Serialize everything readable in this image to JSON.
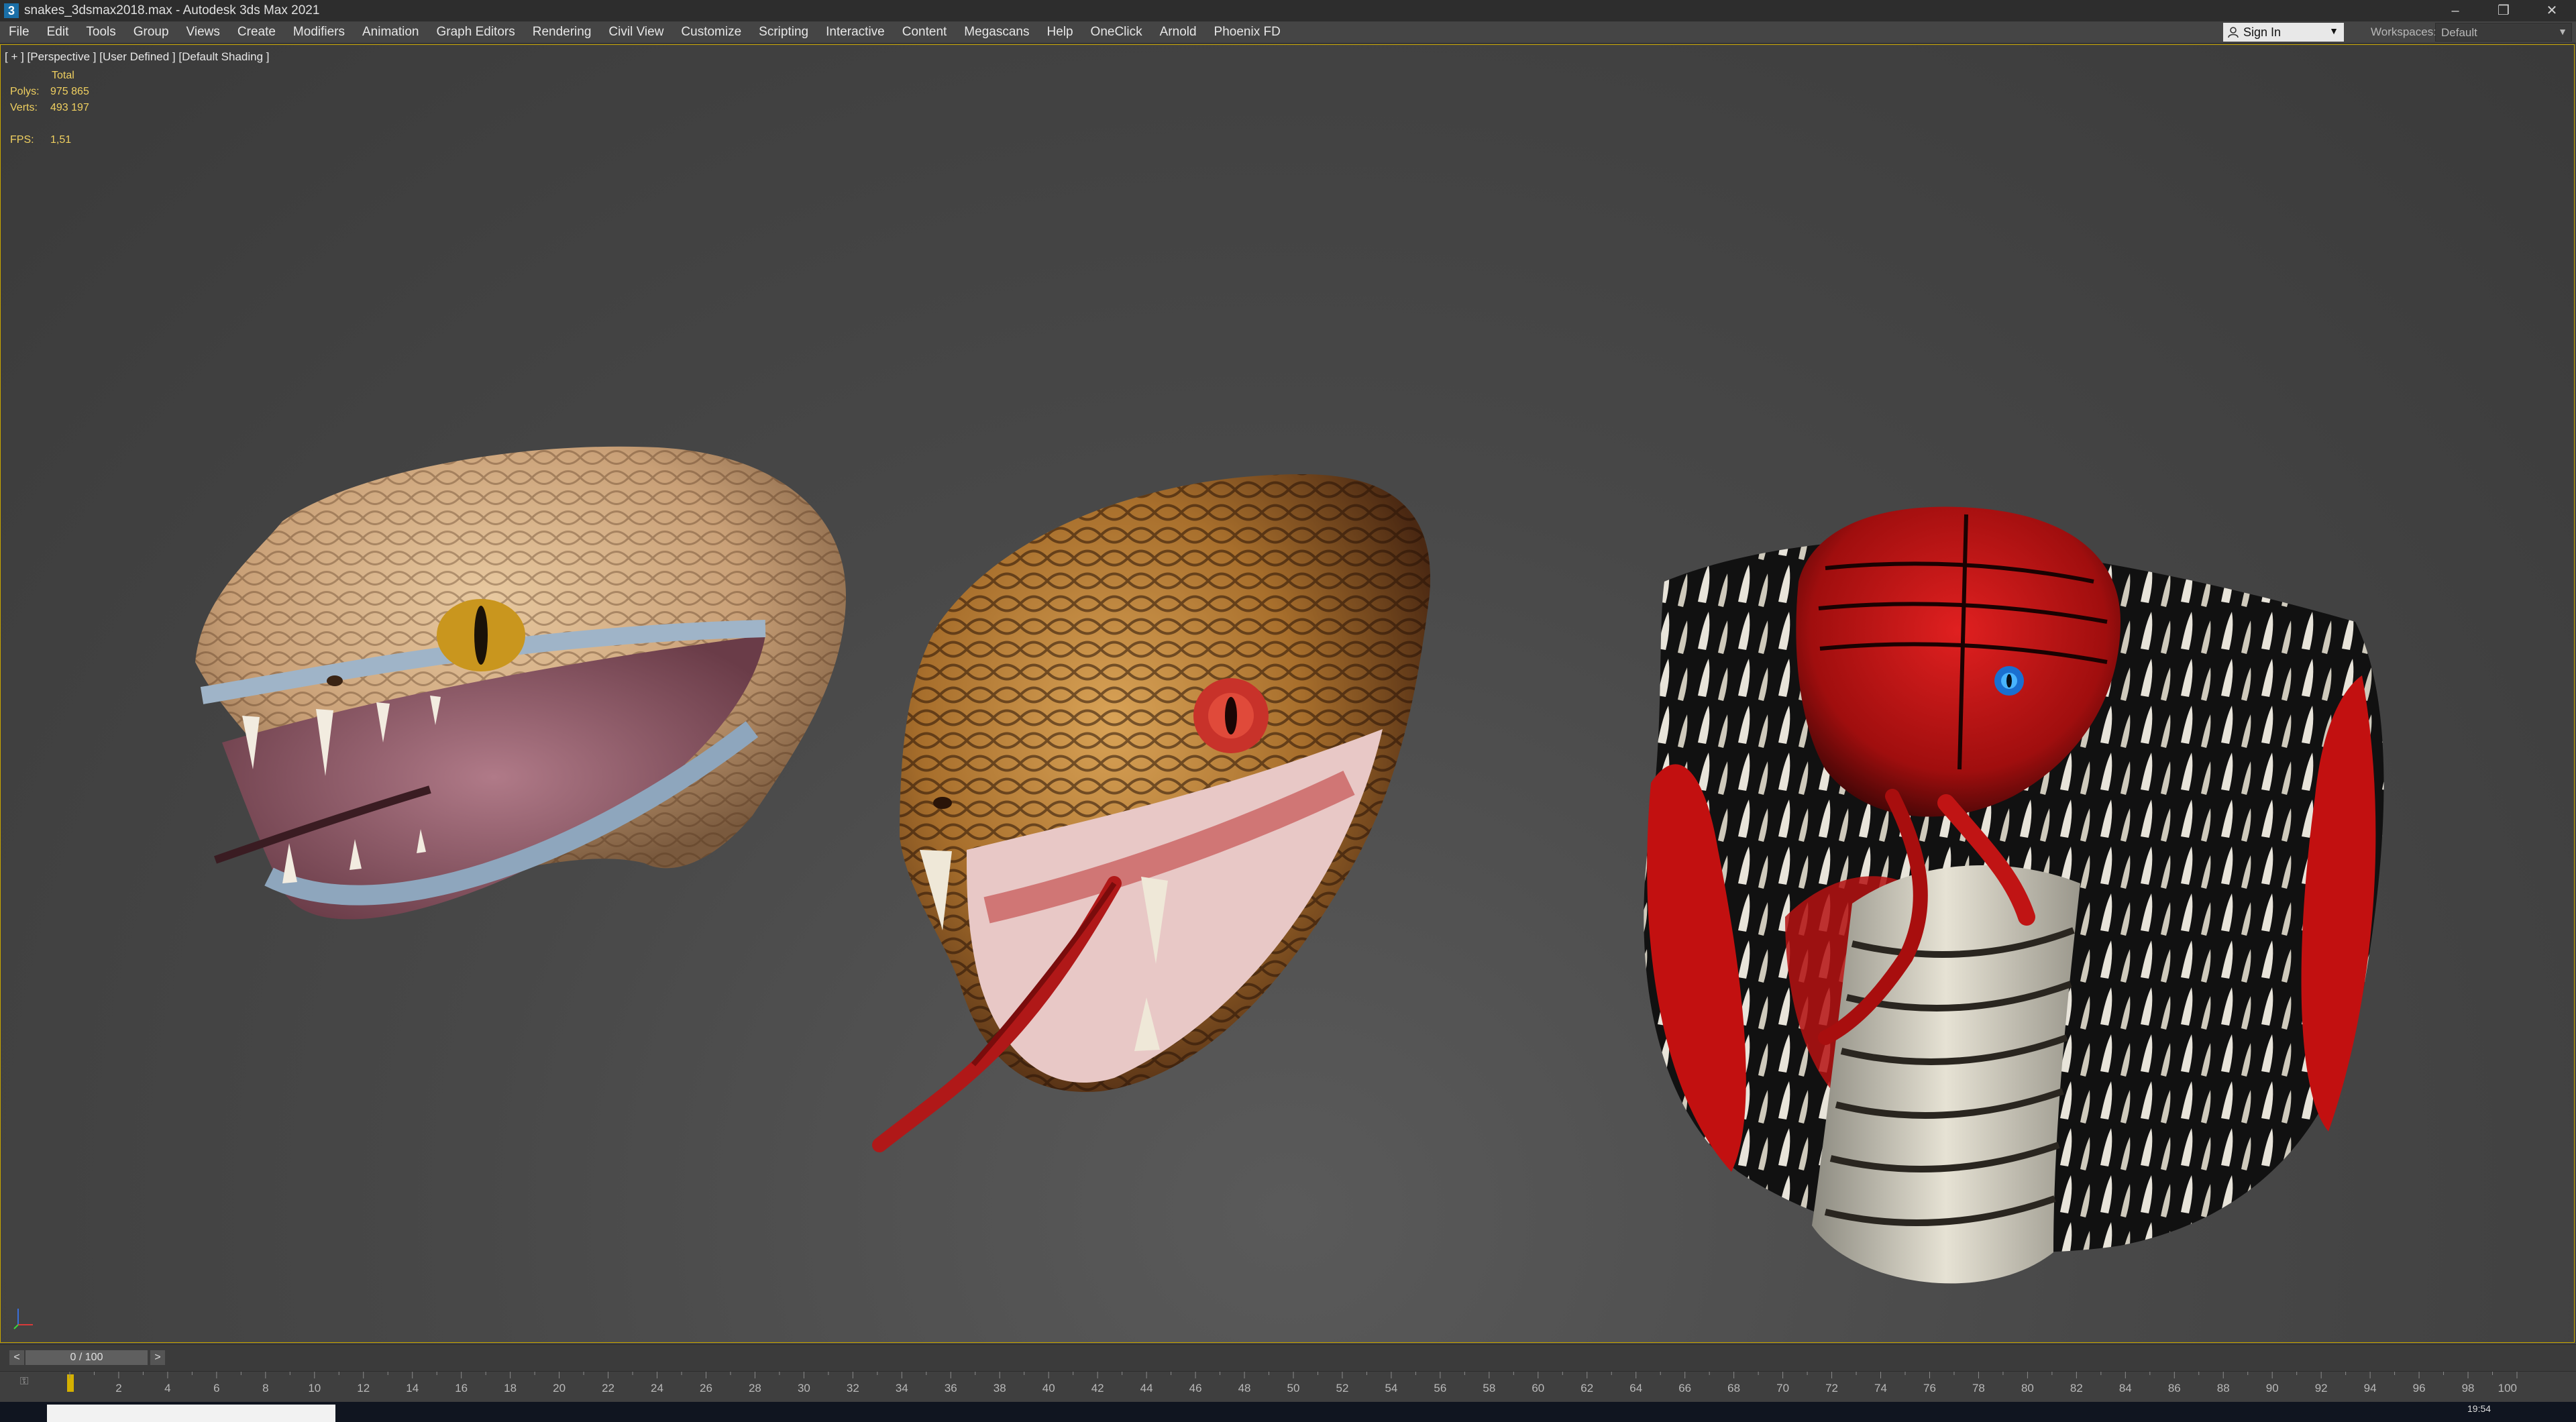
{
  "window": {
    "title": "snakes_3dsmax2018.max - Autodesk 3ds Max 2021",
    "app_icon_letter": "3",
    "controls": {
      "minimize": "–",
      "restore": "❐",
      "close": "✕"
    }
  },
  "menubar": {
    "items": [
      "File",
      "Edit",
      "Tools",
      "Group",
      "Views",
      "Create",
      "Modifiers",
      "Animation",
      "Graph Editors",
      "Rendering",
      "Civil View",
      "Customize",
      "Scripting",
      "Interactive",
      "Content",
      "Megascans",
      "Help",
      "OneClick",
      "Arnold",
      "Phoenix FD"
    ],
    "sign_in": "Sign In",
    "workspaces_label": "Workspaces:",
    "workspace": "Default"
  },
  "viewport": {
    "label": "[ + ] [Perspective ] [User Defined ] [Default Shading ]",
    "stats": {
      "total_label": "Total",
      "polys_label": "Polys:",
      "polys": "975 865",
      "verts_label": "Verts:",
      "verts": "493 197",
      "fps_label": "FPS:",
      "fps": "1,51"
    },
    "objects": [
      "rattlesnake-head",
      "viper-head",
      "cobra-head"
    ],
    "colors": {
      "border": "#c8a600",
      "stats": "#f0d060"
    }
  },
  "timeline": {
    "position": "0 / 100",
    "prev": "<",
    "next": ">",
    "ticks": [
      2,
      4,
      6,
      8,
      10,
      12,
      14,
      16,
      18,
      20,
      22,
      24,
      26,
      28,
      30,
      32,
      34,
      36,
      38,
      40,
      42,
      44,
      46,
      48,
      50,
      52,
      54,
      56,
      58,
      60,
      62,
      64,
      66,
      68,
      70,
      72,
      74,
      76,
      78,
      80,
      82,
      84,
      86,
      88,
      90,
      92,
      94,
      96,
      98,
      100
    ]
  },
  "taskbar": {
    "clock": "19:54"
  }
}
